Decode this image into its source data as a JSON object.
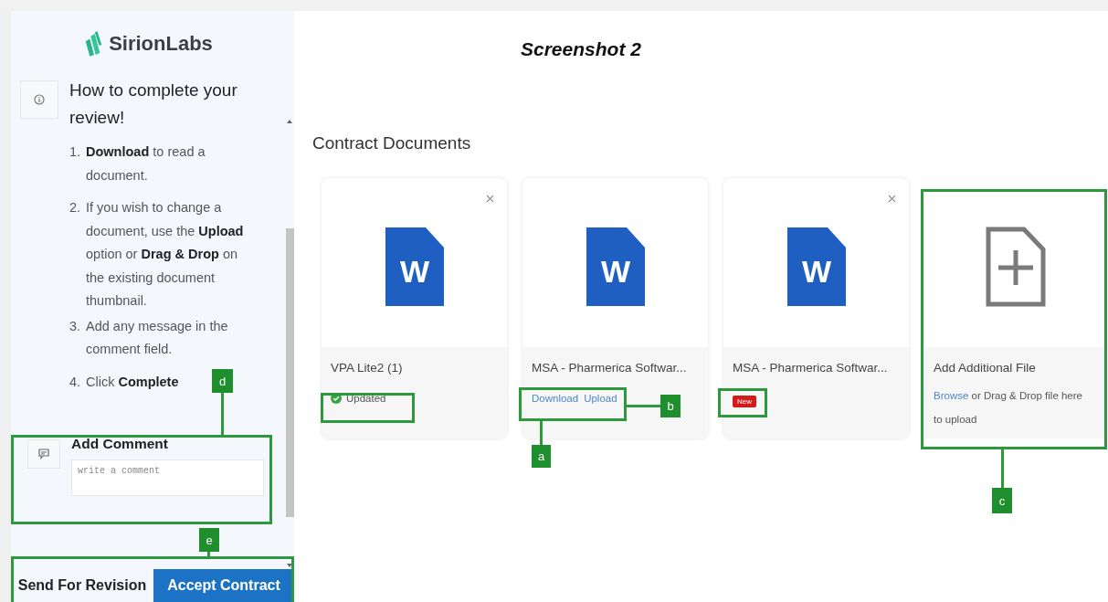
{
  "caption": "Screenshot 2",
  "sidebar": {
    "logo": "SirionLabs",
    "help_title": "How to complete your review!",
    "steps": [
      {
        "number": "1.",
        "text": "**Download** to read a document."
      },
      {
        "number": "2.",
        "text": "If you wish to change a document, use the **Upload** option or **Drag & Drop** on the existing document thumbnail."
      },
      {
        "number": "3.",
        "text": "Add any message in the comment field."
      },
      {
        "number": "4.",
        "text": "Click **Complete**"
      }
    ],
    "comment": {
      "title": "Add Comment",
      "placeholder": "write a comment"
    },
    "buttons": [
      {
        "label": "Send For Revision",
        "kind": "secondary"
      },
      {
        "label": "Accept Contract",
        "kind": "primary"
      }
    ]
  },
  "main": {
    "heading": "Contract Documents",
    "documents": [
      {
        "name": "VPA Lite2 (1)",
        "icon_letter": "W",
        "closable": true,
        "kind": "status",
        "status": "Updated"
      },
      {
        "name": "MSA - Pharmerica Softwar...",
        "icon_letter": "W",
        "closable": false,
        "kind": "actions",
        "actions": [
          "Download",
          "Upload"
        ]
      },
      {
        "name": "MSA - Pharmerica Softwar...",
        "icon_letter": "W",
        "closable": true,
        "kind": "badge",
        "badge": "New"
      }
    ],
    "add_file": {
      "title": "Add Additional File",
      "link": "Browse",
      "text": " or Drag & Drop file here to upload"
    }
  },
  "annotations": [
    {
      "label": "a"
    },
    {
      "label": "b"
    },
    {
      "label": "c"
    },
    {
      "label": "d"
    },
    {
      "label": "e"
    }
  ]
}
